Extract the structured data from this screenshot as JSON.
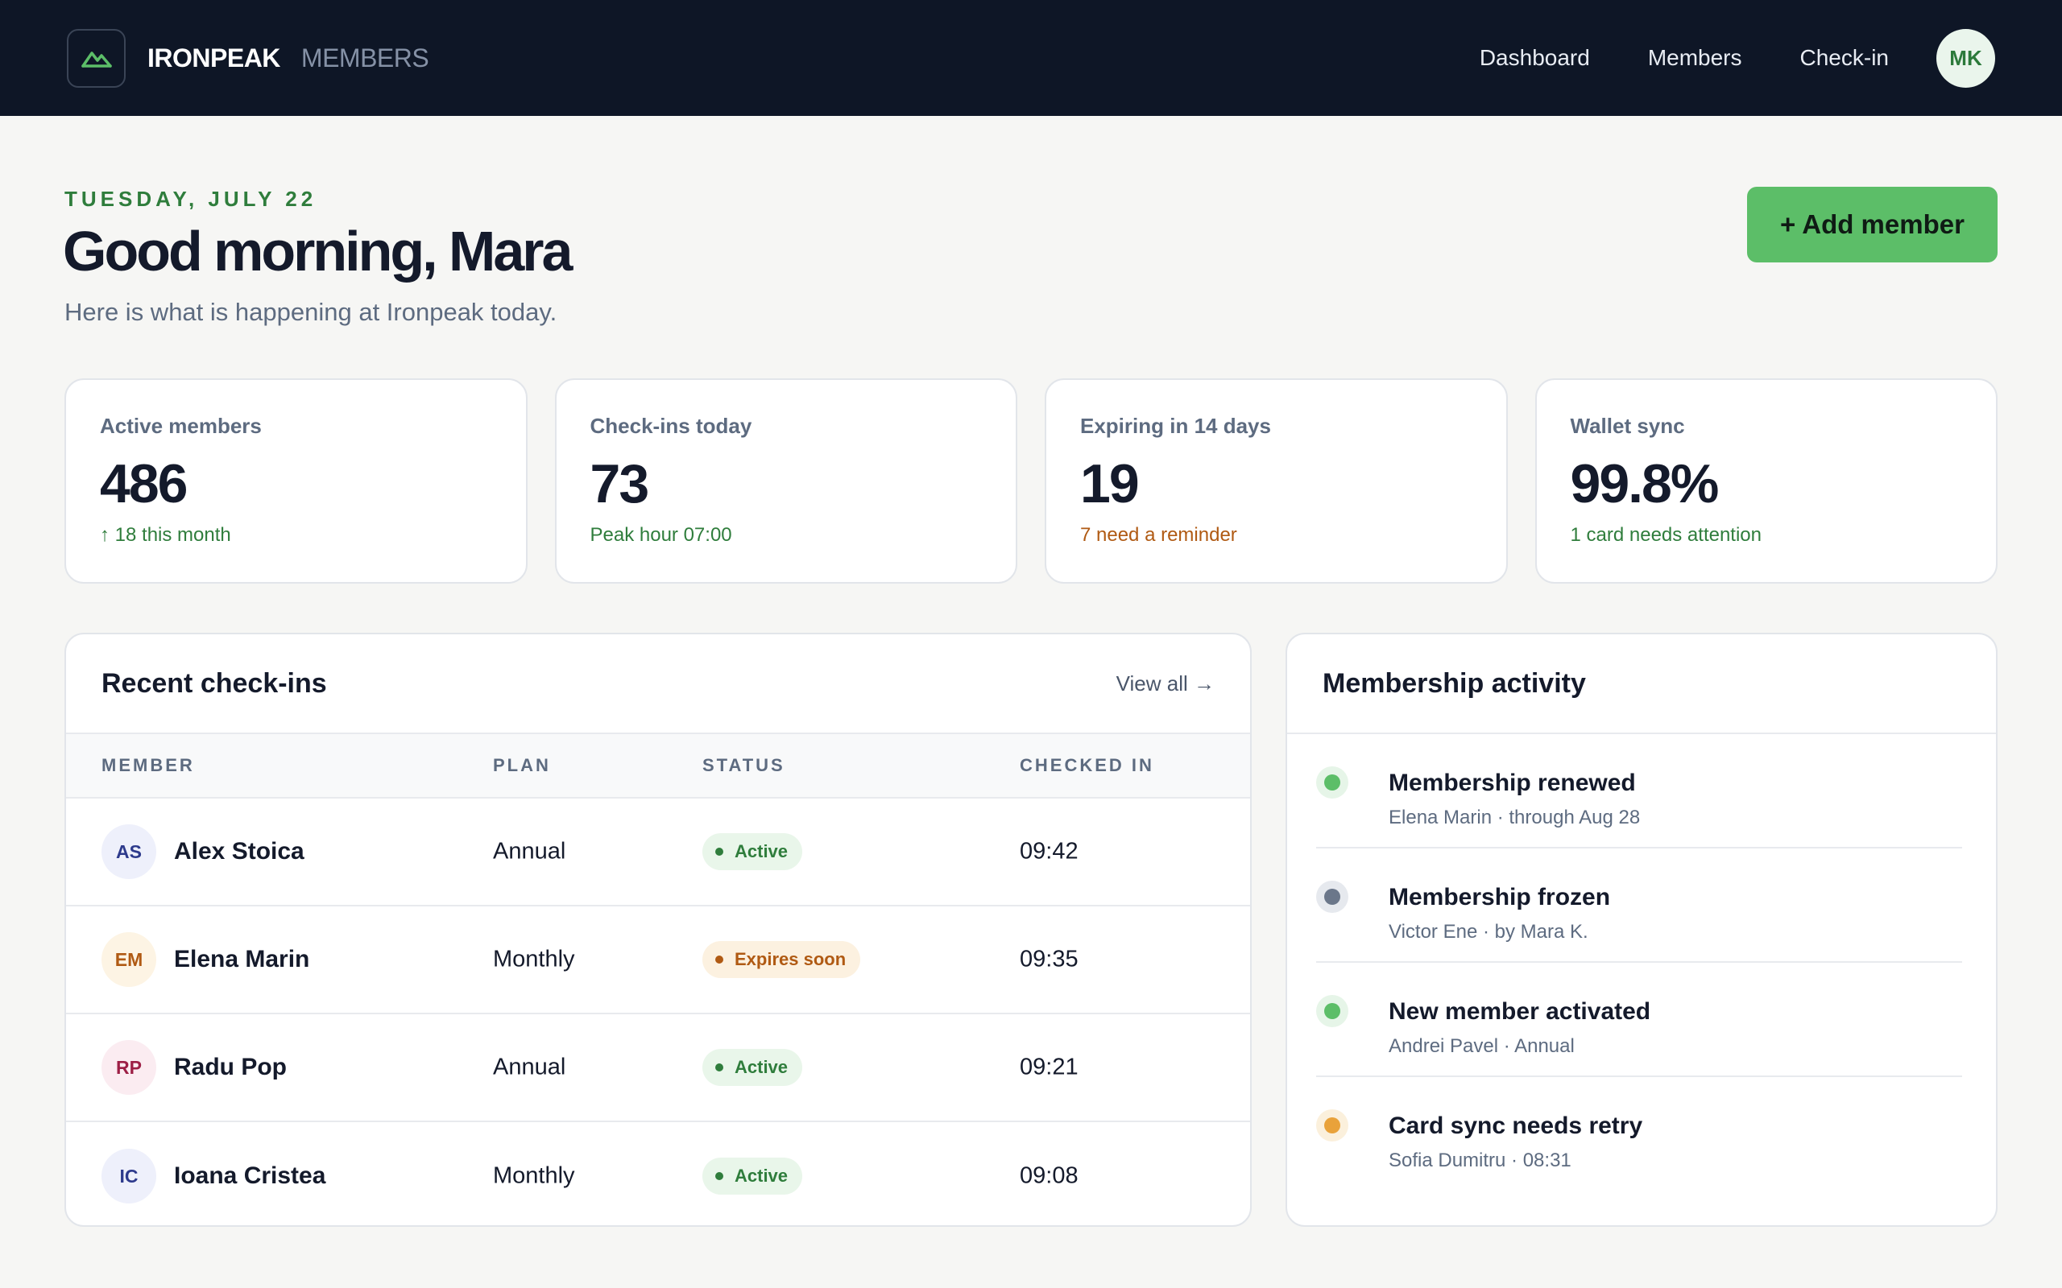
{
  "app": {
    "brand": "IRONPEAK",
    "section": "MEMBERS",
    "logo_icon": "mountain-icon"
  },
  "nav": {
    "items": [
      {
        "label": "Dashboard"
      },
      {
        "label": "Members"
      },
      {
        "label": "Check-in"
      }
    ],
    "user_initials": "MK"
  },
  "header": {
    "date": "TUESDAY, JULY 22",
    "greeting": "Good morning, Mara",
    "subtitle": "Here is what is happening at Ironpeak today.",
    "add_button": "+ Add member"
  },
  "stats": [
    {
      "label": "Active members",
      "value": "486",
      "note": "↑ 18 this month",
      "note_tone": "green"
    },
    {
      "label": "Check-ins today",
      "value": "73",
      "note": "Peak hour 07:00",
      "note_tone": "green"
    },
    {
      "label": "Expiring in 14 days",
      "value": "19",
      "note": "7 need a reminder",
      "note_tone": "orange"
    },
    {
      "label": "Wallet sync",
      "value": "99.8%",
      "note": "1 card needs attention",
      "note_tone": "green"
    }
  ],
  "checkins": {
    "title": "Recent check-ins",
    "view_all": "View all →",
    "columns": [
      "MEMBER",
      "PLAN",
      "STATUS",
      "CHECKED IN"
    ],
    "rows": [
      {
        "initials": "AS",
        "name": "Alex Stoica",
        "plan": "Annual",
        "status": "Active",
        "time": "09:42",
        "avatar_bg": "#eef0fb",
        "avatar_fg": "#2d3a8c",
        "status_tone": "active"
      },
      {
        "initials": "EM",
        "name": "Elena Marin",
        "plan": "Monthly",
        "status": "Expires soon",
        "time": "09:35",
        "avatar_bg": "#fdf4e4",
        "avatar_fg": "#b05a13",
        "status_tone": "warn"
      },
      {
        "initials": "RP",
        "name": "Radu Pop",
        "plan": "Annual",
        "status": "Active",
        "time": "09:21",
        "avatar_bg": "#fbecf1",
        "avatar_fg": "#9d1f46",
        "status_tone": "active"
      },
      {
        "initials": "IC",
        "name": "Ioana Cristea",
        "plan": "Monthly",
        "status": "Active",
        "time": "09:08",
        "avatar_bg": "#eef0fb",
        "avatar_fg": "#2d3a8c",
        "status_tone": "active"
      }
    ]
  },
  "activity": {
    "title": "Membership activity",
    "items": [
      {
        "title": "Membership renewed",
        "sub": "Elena Marin · through Aug 28",
        "dot": "#5cbe68",
        "ring": "#e6f5e8"
      },
      {
        "title": "Membership frozen",
        "sub": "Victor Ene · by Mara K.",
        "dot": "#6b778a",
        "ring": "#e6e9ee"
      },
      {
        "title": "New member activated",
        "sub": "Andrei Pavel · Annual",
        "dot": "#5cbe68",
        "ring": "#e6f5e8"
      },
      {
        "title": "Card sync needs retry",
        "sub": "Sofia Dumitru · 08:31",
        "dot": "#e9a23a",
        "ring": "#fbf0dc"
      }
    ]
  },
  "colors": {
    "nav_bg": "#0e1626",
    "accent_green": "#5cbe68",
    "active_badge_bg": "#e9f6ea",
    "active_badge_fg": "#2f7d3c",
    "warn_badge_bg": "#fcf1e0",
    "warn_badge_fg": "#b05a13"
  }
}
